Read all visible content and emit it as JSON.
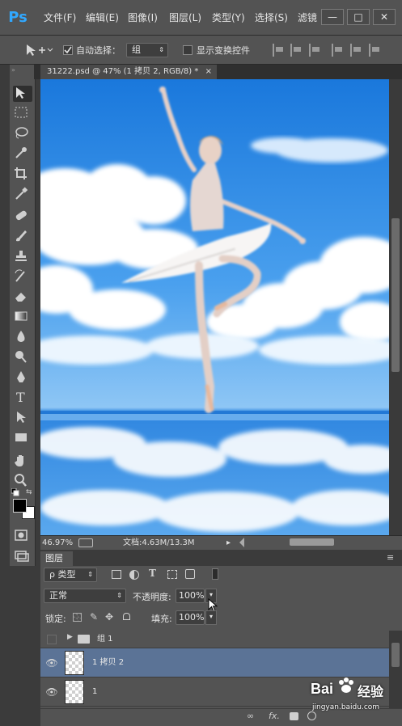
{
  "app": {
    "logo": "Ps",
    "menu": [
      "文件(F)",
      "编辑(E)",
      "图像(I)",
      "图层(L)",
      "类型(Y)",
      "选择(S)",
      "滤镜"
    ],
    "window_controls": [
      "—",
      "□",
      "✕"
    ]
  },
  "options_bar": {
    "auto_select_label": "自动选择：",
    "auto_select_value": "组",
    "show_transform_label": "显示变换控件",
    "auto_select_checked": true,
    "show_transform_checked": false
  },
  "document": {
    "tab_title": "31222.psd @ 47% (1 拷贝 2, RGB/8) *",
    "tab_close": "×"
  },
  "status": {
    "zoom": "46.97%",
    "doc_info": "文档:4.63M/13.3M",
    "arrow": "▸"
  },
  "layers_panel": {
    "tab_label": "图层",
    "filter_label": "ρ 类型",
    "blend_mode": "正常",
    "opacity_label": "不透明度:",
    "opacity_value": "100%",
    "lock_label": "锁定:",
    "fill_label": "填充:",
    "fill_value": "100%",
    "layers": [
      {
        "name": "组 1",
        "type": "group",
        "visible": false,
        "selected": false
      },
      {
        "name": "1 拷贝 2",
        "type": "layer",
        "visible": true,
        "selected": true
      },
      {
        "name": "1",
        "type": "layer",
        "visible": true,
        "selected": false
      }
    ],
    "footer": [
      "fx."
    ]
  },
  "watermark": {
    "brand": "Bai",
    "brand2": "经验",
    "url": "jingyan.baidu.com"
  },
  "colors": {
    "accent": "#31a8ff",
    "selected_layer": "#5b7396",
    "sky": "#1d7fe0"
  }
}
